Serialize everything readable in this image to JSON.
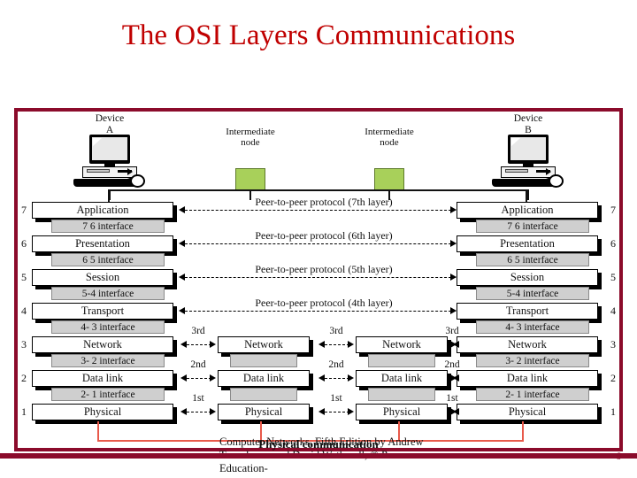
{
  "slide": {
    "title": "The OSI Layers Communications",
    "page_number": "6"
  },
  "diagram": {
    "devices": [
      {
        "name": "device-a",
        "caption_line1": "Device",
        "caption_line2": "A"
      },
      {
        "name": "device-b",
        "caption_line1": "Device",
        "caption_line2": "B"
      }
    ],
    "intermediate_nodes": [
      {
        "caption_line1": "Intermediate",
        "caption_line2": "node",
        "color": "#A8D05A"
      },
      {
        "caption_line1": "Intermediate",
        "caption_line2": "node",
        "color": "#A8D05A"
      }
    ],
    "end_stack": {
      "layers": [
        {
          "num": "7",
          "label": "Application"
        },
        {
          "num": "6",
          "label": "Presentation"
        },
        {
          "num": "5",
          "label": "Session"
        },
        {
          "num": "4",
          "label": "Transport"
        },
        {
          "num": "3",
          "label": "Network"
        },
        {
          "num": "2",
          "label": "Data link"
        },
        {
          "num": "1",
          "label": "Physical"
        }
      ],
      "interfaces": [
        "7  6 interface",
        "6  5 interface",
        "5-4 interface",
        "4- 3 interface",
        "3- 2 interface",
        "2- 1 interface"
      ]
    },
    "node_stack": {
      "layers": [
        {
          "label": "Network"
        },
        {
          "label": "Data link"
        },
        {
          "label": "Physical"
        }
      ],
      "interfaces": [
        "",
        ""
      ]
    },
    "peer_protocols": [
      "Peer-to-peer protocol (7th layer)",
      "Peer-to-peer protocol (6th layer)",
      "Peer-to-peer protocol (5th layer)",
      "Peer-to-peer protocol (4th layer)"
    ],
    "hop_labels": [
      "3rd",
      "2nd",
      "1st"
    ],
    "physical_communication_label": "Physical communication",
    "credit": "Computer Networks, Fifth Edition by Andrew Tanenbaum and David Wetherall, © Pearson Education-",
    "colors": {
      "frame": "#8B0B2B",
      "title": "#C00000",
      "node_green": "#A8D05A",
      "interface_gray": "#CFCFCF",
      "physical_red": "#E8594A"
    }
  }
}
